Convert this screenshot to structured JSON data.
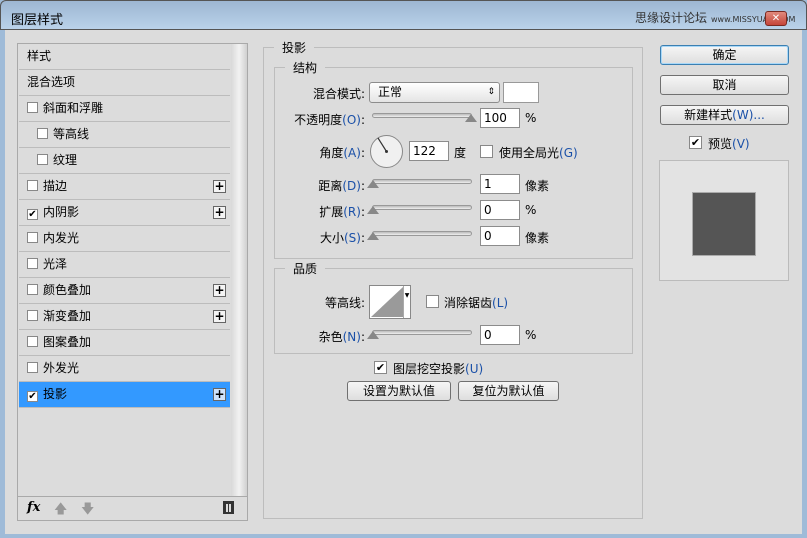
{
  "window": {
    "title": "图层样式",
    "watermark": "思缘设计论坛",
    "watermark_url": "www.MISSYUAN.COM",
    "close": "✕"
  },
  "sidebar": {
    "items": [
      {
        "label": "样式",
        "checkbox": false,
        "checked": false,
        "plus": false,
        "indent": false,
        "selected": false
      },
      {
        "label": "混合选项",
        "checkbox": false,
        "checked": false,
        "plus": false,
        "indent": false,
        "selected": false
      },
      {
        "label": "斜面和浮雕",
        "checkbox": true,
        "checked": false,
        "plus": false,
        "indent": false,
        "selected": false
      },
      {
        "label": "等高线",
        "checkbox": true,
        "checked": false,
        "plus": false,
        "indent": true,
        "selected": false
      },
      {
        "label": "纹理",
        "checkbox": true,
        "checked": false,
        "plus": false,
        "indent": true,
        "selected": false
      },
      {
        "label": "描边",
        "checkbox": true,
        "checked": false,
        "plus": true,
        "indent": false,
        "selected": false
      },
      {
        "label": "内阴影",
        "checkbox": true,
        "checked": true,
        "plus": true,
        "indent": false,
        "selected": false
      },
      {
        "label": "内发光",
        "checkbox": true,
        "checked": false,
        "plus": false,
        "indent": false,
        "selected": false
      },
      {
        "label": "光泽",
        "checkbox": true,
        "checked": false,
        "plus": false,
        "indent": false,
        "selected": false
      },
      {
        "label": "颜色叠加",
        "checkbox": true,
        "checked": false,
        "plus": true,
        "indent": false,
        "selected": false
      },
      {
        "label": "渐变叠加",
        "checkbox": true,
        "checked": false,
        "plus": true,
        "indent": false,
        "selected": false
      },
      {
        "label": "图案叠加",
        "checkbox": true,
        "checked": false,
        "plus": false,
        "indent": false,
        "selected": false
      },
      {
        "label": "外发光",
        "checkbox": true,
        "checked": false,
        "plus": false,
        "indent": false,
        "selected": false
      },
      {
        "label": "投影",
        "checkbox": true,
        "checked": true,
        "plus": true,
        "indent": false,
        "selected": true
      }
    ],
    "fx": "fx"
  },
  "main": {
    "title": "投影",
    "structure": {
      "title": "结构",
      "blend_mode": {
        "label": "混合模式",
        "suffix": ":",
        "value": "正常"
      },
      "opacity": {
        "label": "不透明度",
        "sc": "(O)",
        "suffix": ":",
        "value": "100",
        "unit": "%",
        "percent": 100
      },
      "angle": {
        "label": "角度",
        "sc": "(A)",
        "suffix": ":",
        "value": "122",
        "unit": "度",
        "global_light_label": "使用全局光",
        "global_light_sc": "(G)",
        "global_light_checked": false
      },
      "distance": {
        "label": "距离",
        "sc": "(D)",
        "suffix": ":",
        "value": "1",
        "unit": "像素"
      },
      "spread": {
        "label": "扩展",
        "sc": "(R)",
        "suffix": ":",
        "value": "0",
        "unit": "%"
      },
      "size": {
        "label": "大小",
        "sc": "(S)",
        "suffix": ":",
        "value": "0",
        "unit": "像素"
      }
    },
    "quality": {
      "title": "品质",
      "contour": {
        "label": "等高线",
        "suffix": ":",
        "anti_alias_label": "消除锯齿",
        "anti_alias_sc": "(L)",
        "anti_alias_checked": false
      },
      "noise": {
        "label": "杂色",
        "sc": "(N)",
        "suffix": ":",
        "value": "0",
        "unit": "%"
      }
    },
    "knockout": {
      "label": "图层挖空投影",
      "sc": "(U)",
      "checked": true
    },
    "make_default": "设置为默认值",
    "reset_default": "复位为默认值"
  },
  "right": {
    "ok": "确定",
    "cancel": "取消",
    "new_style": "新建样式",
    "new_style_sc": "(W)...",
    "preview_label": "预览",
    "preview_sc": "(V)",
    "preview_checked": true,
    "preview_color": "#555555"
  }
}
